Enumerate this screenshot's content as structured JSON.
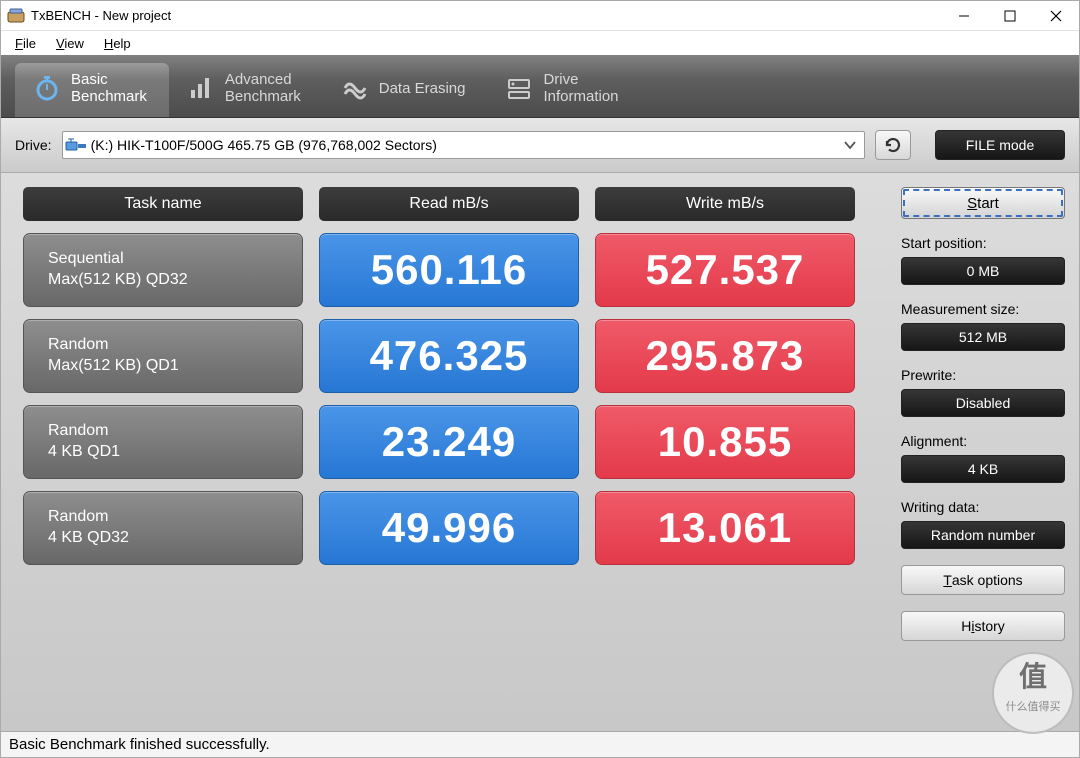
{
  "title": "TxBENCH - New project",
  "menu": {
    "file": "File",
    "view": "View",
    "help": "Help"
  },
  "tabs": {
    "basic": {
      "l1": "Basic",
      "l2": "Benchmark"
    },
    "advanced": {
      "l1": "Advanced",
      "l2": "Benchmark"
    },
    "erase": {
      "l1": "Data Erasing"
    },
    "drive": {
      "l1": "Drive",
      "l2": "Information"
    }
  },
  "toolbar": {
    "drive_label": "Drive:",
    "drive_text": "(K:) HIK-T100F/500G  465.75 GB (976,768,002 Sectors)",
    "file_mode": "FILE mode"
  },
  "table": {
    "headers": {
      "task": "Task name",
      "read": "Read mB/s",
      "write": "Write mB/s"
    },
    "rows": [
      {
        "name1": "Sequential",
        "name2": "Max(512 KB) QD32",
        "read": "560.116",
        "write": "527.537"
      },
      {
        "name1": "Random",
        "name2": "Max(512 KB) QD1",
        "read": "476.325",
        "write": "295.873"
      },
      {
        "name1": "Random",
        "name2": "4 KB QD1",
        "read": "23.249",
        "write": "10.855"
      },
      {
        "name1": "Random",
        "name2": "4 KB QD32",
        "read": "49.996",
        "write": "13.061"
      }
    ]
  },
  "sidebar": {
    "start": "Start",
    "start_position_label": "Start position:",
    "start_position_value": "0 MB",
    "measurement_size_label": "Measurement size:",
    "measurement_size_value": "512 MB",
    "prewrite_label": "Prewrite:",
    "prewrite_value": "Disabled",
    "alignment_label": "Alignment:",
    "alignment_value": "4 KB",
    "writing_data_label": "Writing data:",
    "writing_data_value": "Random number",
    "task_options": "Task options",
    "history": "History"
  },
  "status": "Basic Benchmark finished successfully.",
  "watermark": "什么值得买"
}
